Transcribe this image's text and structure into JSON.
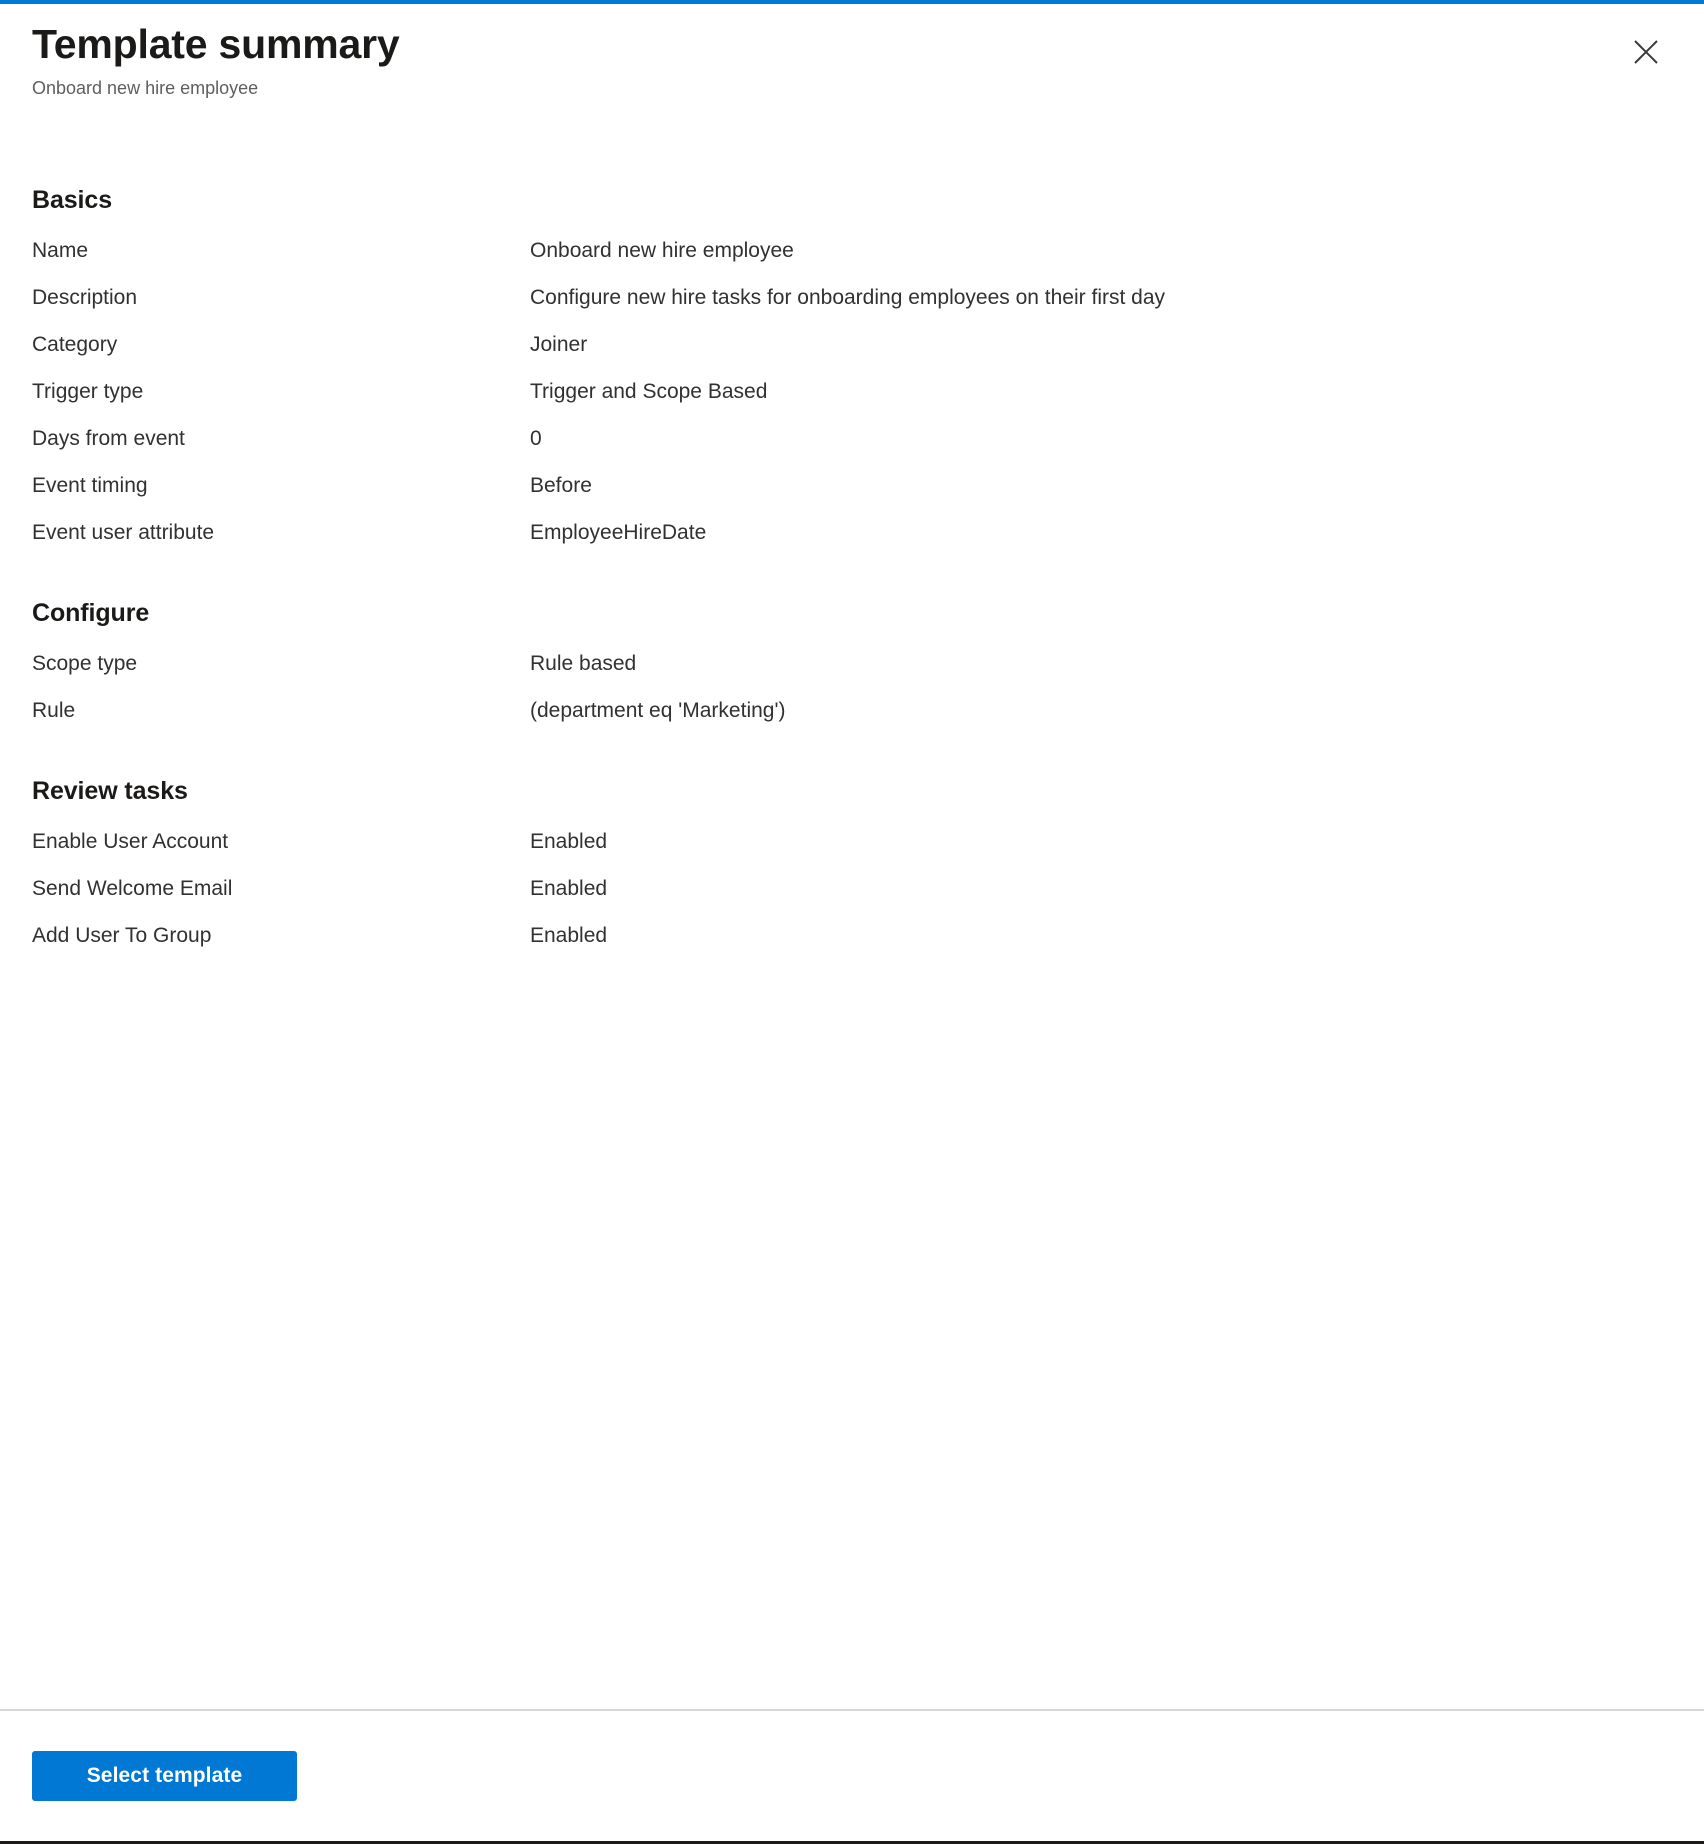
{
  "header": {
    "title": "Template summary",
    "subtitle": "Onboard new hire employee",
    "close_icon": "close-icon"
  },
  "sections": [
    {
      "heading": "Basics",
      "rows": [
        {
          "label": "Name",
          "value": "Onboard new hire employee"
        },
        {
          "label": "Description",
          "value": "Configure new hire tasks for onboarding employees on their first day"
        },
        {
          "label": "Category",
          "value": "Joiner"
        },
        {
          "label": "Trigger type",
          "value": "Trigger and Scope Based"
        },
        {
          "label": "Days from event",
          "value": "0"
        },
        {
          "label": "Event timing",
          "value": "Before"
        },
        {
          "label": "Event user attribute",
          "value": "EmployeeHireDate"
        }
      ]
    },
    {
      "heading": "Configure",
      "rows": [
        {
          "label": "Scope type",
          "value": "Rule based"
        },
        {
          "label": "Rule",
          "value": "(department eq 'Marketing')"
        }
      ]
    },
    {
      "heading": "Review tasks",
      "rows": [
        {
          "label": "Enable User Account",
          "value": "Enabled"
        },
        {
          "label": "Send Welcome Email",
          "value": "Enabled"
        },
        {
          "label": "Add User To Group",
          "value": "Enabled"
        }
      ]
    }
  ],
  "footer": {
    "primary_button_label": "Select template"
  },
  "colors": {
    "accent": "#0078d4",
    "text_primary": "#323130",
    "text_heading": "#1b1a19",
    "text_secondary": "#605e5c",
    "divider": "#d6d6d6"
  }
}
